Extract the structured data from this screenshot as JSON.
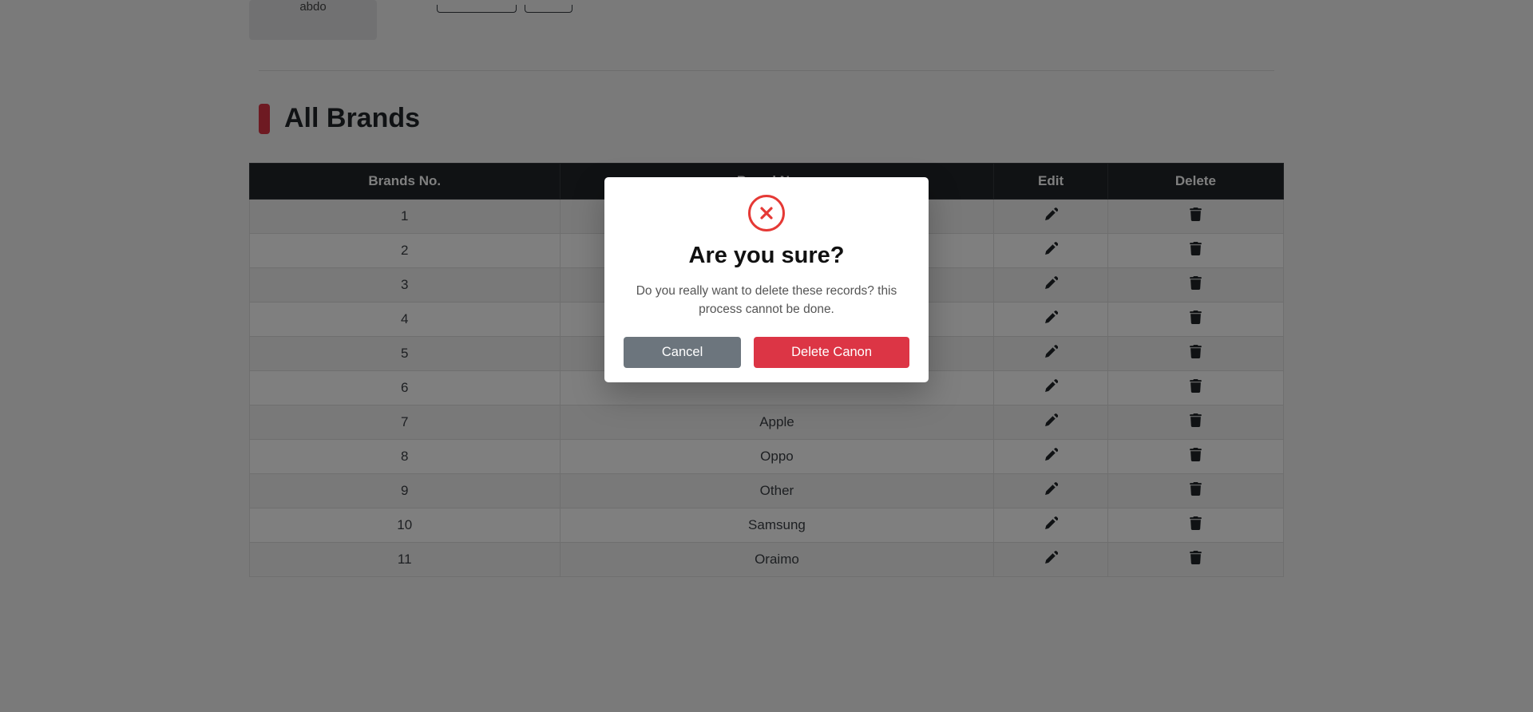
{
  "top": {
    "card_name": "abdo"
  },
  "page": {
    "title": "All Brands"
  },
  "table": {
    "headers": {
      "no": "Brands No.",
      "name": "Brand Name",
      "edit": "Edit",
      "delete": "Delete"
    },
    "rows": [
      {
        "no": "1",
        "name": ""
      },
      {
        "no": "2",
        "name": ""
      },
      {
        "no": "3",
        "name": ""
      },
      {
        "no": "4",
        "name": ""
      },
      {
        "no": "5",
        "name": ""
      },
      {
        "no": "6",
        "name": ""
      },
      {
        "no": "7",
        "name": "Apple"
      },
      {
        "no": "8",
        "name": "Oppo"
      },
      {
        "no": "9",
        "name": "Other"
      },
      {
        "no": "10",
        "name": "Samsung"
      },
      {
        "no": "11",
        "name": "Oraimo"
      }
    ]
  },
  "modal": {
    "title": "Are you sure?",
    "body": "Do you really want to delete these records? this process cannot be done.",
    "cancel": "Cancel",
    "confirm": "Delete Canon"
  }
}
